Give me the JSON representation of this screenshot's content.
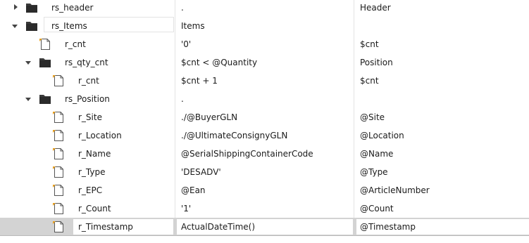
{
  "rows": [
    {
      "name": "rs_header",
      "expression": ".",
      "target": "Header",
      "node": "record-set",
      "state": "collapsed"
    },
    {
      "name": "rs_Items",
      "expression": "Items",
      "target": "",
      "node": "record-set",
      "state": "expanded"
    },
    {
      "name": "r_cnt",
      "expression": "'0'",
      "target": "$cnt",
      "node": "rule",
      "state": "none"
    },
    {
      "name": "rs_qty_cnt",
      "expression": "$cnt < @Quantity",
      "target": "Position",
      "node": "record-set",
      "state": "expanded"
    },
    {
      "name": "r_cnt",
      "expression": "$cnt + 1",
      "target": "$cnt",
      "node": "rule",
      "state": "none"
    },
    {
      "name": "rs_Position",
      "expression": ".",
      "target": "",
      "node": "record-set",
      "state": "expanded"
    },
    {
      "name": "r_Site",
      "expression": "./@BuyerGLN",
      "target": "@Site",
      "node": "rule",
      "state": "none"
    },
    {
      "name": "r_Location",
      "expression": "./@UltimateConsignyGLN",
      "target": "@Location",
      "node": "rule",
      "state": "none"
    },
    {
      "name": "r_Name",
      "expression": "@SerialShippingContainerCode",
      "target": "@Name",
      "node": "rule",
      "state": "none"
    },
    {
      "name": "r_Type",
      "expression": "'DESADV'",
      "target": "@Type",
      "node": "rule",
      "state": "none"
    },
    {
      "name": "r_EPC",
      "expression": "@Ean",
      "target": "@ArticleNumber",
      "node": "rule",
      "state": "none"
    },
    {
      "name": "r_Count",
      "expression": "'1'",
      "target": "@Count",
      "node": "rule",
      "state": "none"
    },
    {
      "name": "r_Timestamp",
      "expression": "ActualDateTime()",
      "target": "@Timestamp",
      "node": "rule",
      "state": "none"
    }
  ],
  "selected_row": "r_Timestamp",
  "icons": {
    "record-set": "folder-icon",
    "rule": "document-icon"
  },
  "colors": {
    "folder": "#3a3a3a",
    "document_outline": "#555555",
    "document_marker": "#e8a020",
    "selection": "#d3d3d3"
  }
}
